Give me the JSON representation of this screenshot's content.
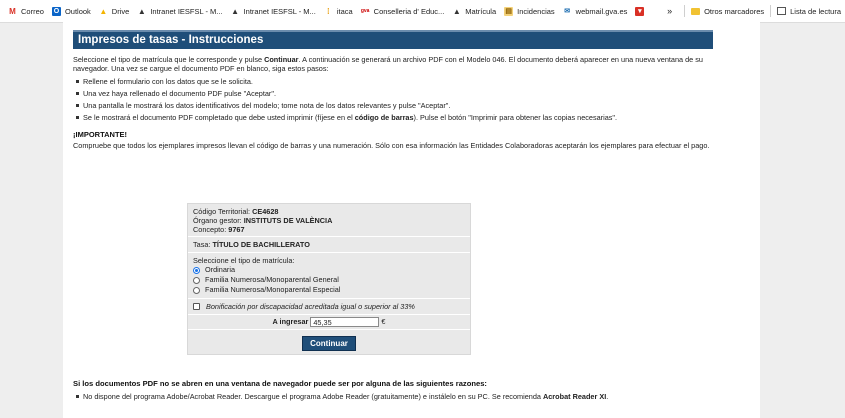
{
  "bookmarks": {
    "correo": "Correo",
    "outlook": "Outlook",
    "drive": "Drive",
    "intranet1": "Intranet IESFSL - M...",
    "intranet2": "Intranet IESFSL - M...",
    "itaca": "itaca",
    "conselleria": "Conselleria d' Educ...",
    "matricula": "Matrícula",
    "incidencias": "Incidencias",
    "webmail": "webmail.gva.es",
    "more": "»",
    "otros": "Otros marcadores",
    "lista": "Lista de lectura"
  },
  "page": {
    "header": "Impresos de tasas - Instrucciones",
    "intro_1": "Seleccione el tipo de matrícula que le corresponde y pulse ",
    "intro_bold": "Continuar",
    "intro_2": ". A continuación se generará un archivo PDF con el Modelo 046. El documento deberá aparecer en una nueva ventana de su navegador. Una vez se cargue el documento PDF en blanco, siga estos pasos:",
    "steps": [
      "Rellene el formulario con los datos que se le solicita.",
      "Una vez haya rellenado el documento PDF pulse \"Aceptar\".",
      "Una pantalla le mostrará los datos identificativos del modelo; tome nota de los datos relevantes y pulse \"Aceptar\"."
    ],
    "step4_1": "Se le mostrará el documento PDF completado que debe usted imprimir (fíjese en el ",
    "step4_bold": "código de barras",
    "step4_2": "). Pulse el botón \"Imprimir para obtener las copias necesarias\".",
    "important_title": "¡IMPORTANTE!",
    "important_text": "Compruebe que todos los ejemplares impresos llevan el código de barras y una numeración. Sólo con esa información las Entidades Colaboradoras aceptarán los ejemplares para efectuar el pago."
  },
  "form": {
    "codigo_label": "Código Territorial: ",
    "codigo_value": "CE4628",
    "organo_label": "Órgano gestor: ",
    "organo_value": "INSTITUTS DE VALÈNCIA",
    "concepto_label": "Concepto: ",
    "concepto_value": "9767",
    "tasa_label": "Tasa: ",
    "tasa_value": "TÍTULO DE BACHILLERATO",
    "tipo_label": "Seleccione el tipo de matrícula:",
    "options": [
      "Ordinaria",
      "Familia Numerosa/Monoparental General",
      "Familia Numerosa/Monoparental Especial"
    ],
    "bonificacion": "Bonificación por discapacidad acreditada igual o superior al 33%",
    "ingresar_label": "A ingresar",
    "ingresar_value": "45,35",
    "currency": "€",
    "continuar": "Continuar"
  },
  "bottom": {
    "title": "Si los documentos PDF no se abren en una ventana de navegador puede ser por alguna de las siguientes razones:",
    "item_1": "No dispone del programa Adobe/Acrobat Reader. Descargue el programa Adobe Reader (gratuitamente) e instálelo en su PC. Se recomienda ",
    "item_bold": "Acrobat Reader XI",
    "item_2": "."
  }
}
